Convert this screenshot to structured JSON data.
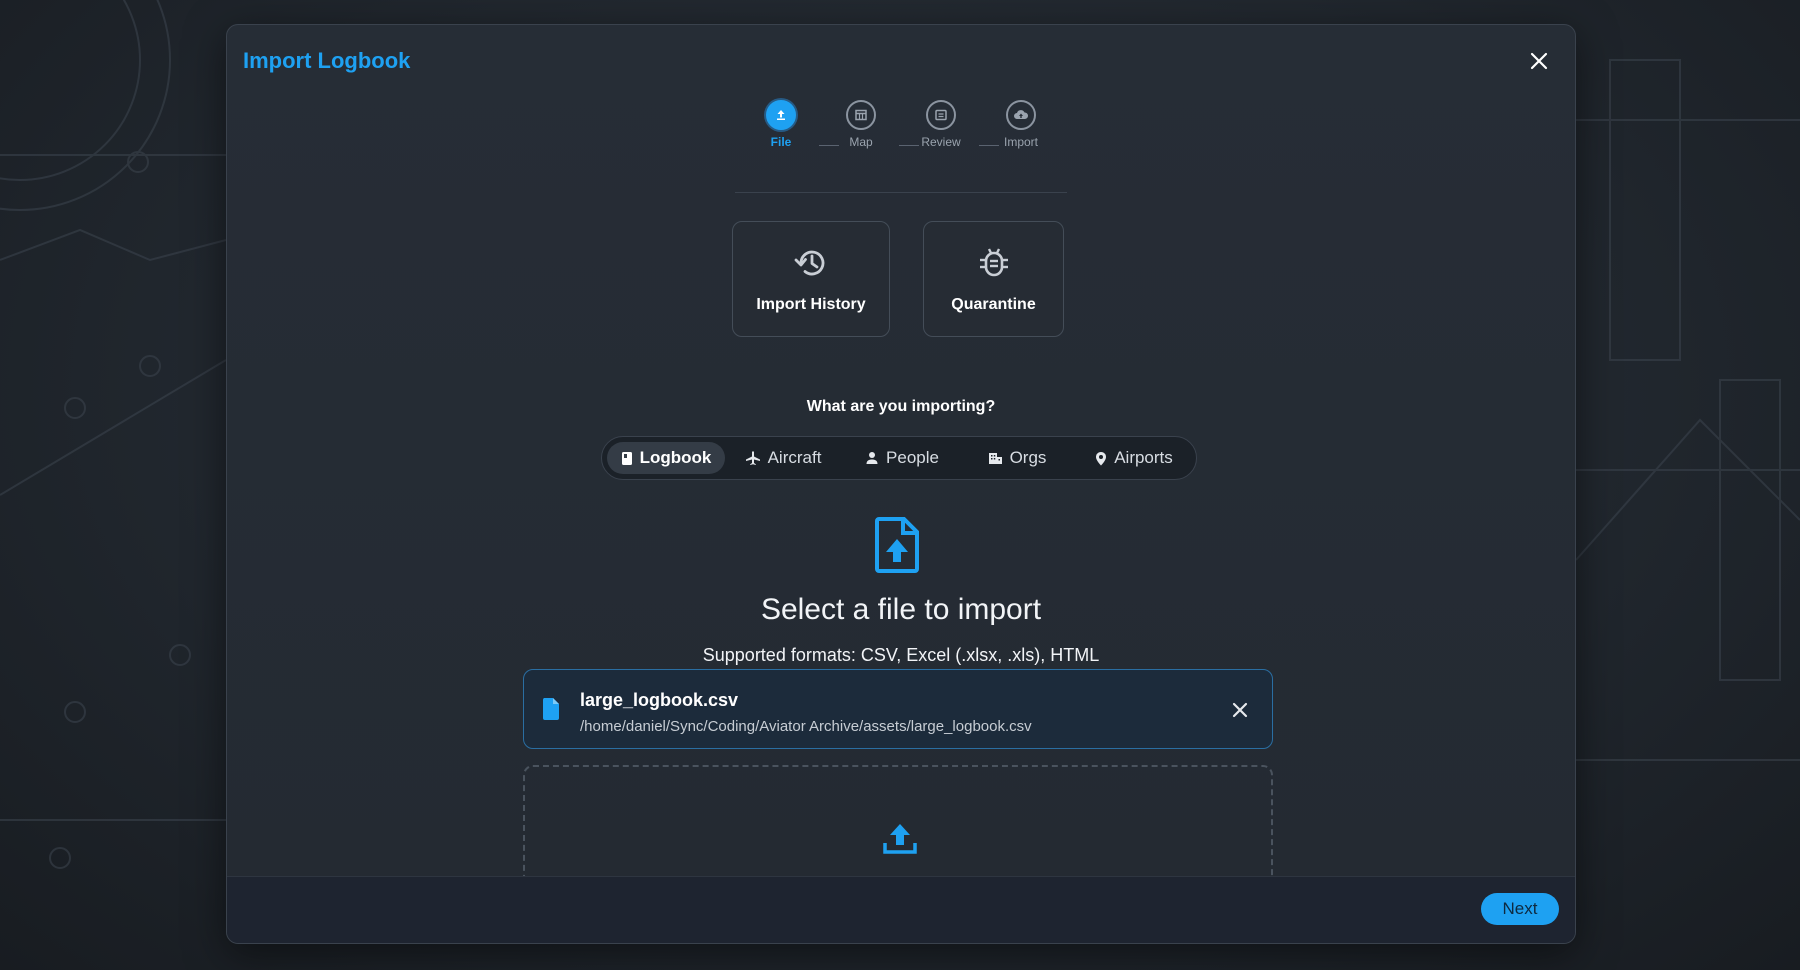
{
  "dialog": {
    "title": "Import Logbook",
    "close_icon": "close-icon"
  },
  "stepper": {
    "steps": [
      {
        "label": "File",
        "icon": "upload-icon",
        "active": true
      },
      {
        "label": "Map",
        "icon": "table-icon",
        "active": false
      },
      {
        "label": "Review",
        "icon": "review-icon",
        "active": false
      },
      {
        "label": "Import",
        "icon": "cloud-upload-icon",
        "active": false
      }
    ]
  },
  "tiles": {
    "history": {
      "label": "Import History",
      "icon": "history-icon"
    },
    "quarantine": {
      "label": "Quarantine",
      "icon": "bug-icon"
    }
  },
  "question": "What are you importing?",
  "import_types": {
    "selected": "Logbook",
    "items": [
      {
        "label": "Logbook",
        "icon": "book-icon"
      },
      {
        "label": "Aircraft",
        "icon": "airplane-icon"
      },
      {
        "label": "People",
        "icon": "person-icon"
      },
      {
        "label": "Orgs",
        "icon": "building-icon"
      },
      {
        "label": "Airports",
        "icon": "location-pin-icon"
      }
    ]
  },
  "upload": {
    "icon": "file-upload-icon",
    "title": "Select a file to import",
    "formats": "Supported formats: CSV, Excel (.xlsx, .xls), HTML"
  },
  "selected_file": {
    "name": "large_logbook.csv",
    "path": "/home/daniel/Sync/Coding/Aviator Archive/assets/large_logbook.csv",
    "icon": "document-icon"
  },
  "dropzone": {
    "icon": "upload-arrow-icon"
  },
  "footer": {
    "next_label": "Next"
  },
  "colors": {
    "accent": "#1ea1f2",
    "dialog_bg": "#262d36",
    "file_card_bg": "#1c2b3b",
    "file_card_border": "#2a6ea2",
    "footer_bg": "#1e2430"
  }
}
